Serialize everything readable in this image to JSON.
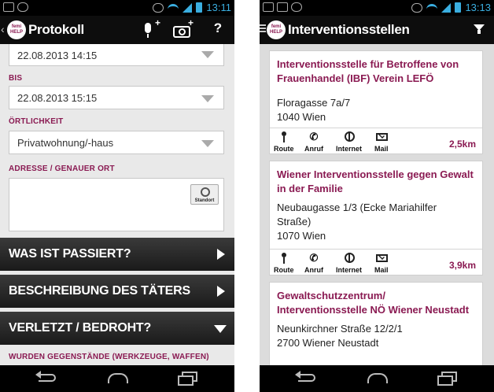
{
  "left": {
    "status_time": "13:11",
    "title": "Protokoll",
    "logo_text_1": "femi",
    "logo_text_2": "HELP",
    "help_label": "?",
    "start_value": "22.08.2013 14:15",
    "bis_label": "BIS",
    "bis_value": "22.08.2013 15:15",
    "oertlichkeit_label": "ÖRTLICHKEIT",
    "oertlichkeit_value": "Privatwohnung/-haus",
    "adresse_label": "ADRESSE / GENAUER ORT",
    "standort_label": "Standort",
    "sections": [
      "WAS IST PASSIERT?",
      "BESCHREIBUNG DES TÄTERS",
      "VERLETZT / BEDROHT?"
    ],
    "gegenstaende_label": "WURDEN GEGENSTÄNDE (WERKZEUGE, WAFFEN)"
  },
  "right": {
    "status_time": "13:13",
    "title": "Interventionsstellen",
    "logo_text_1": "femi",
    "logo_text_2": "HELP",
    "actions": [
      "Route",
      "Anruf",
      "Internet",
      "Mail"
    ],
    "cards": [
      {
        "title_1": "Interventionsstelle für Betroffene von",
        "title_2": "Frauenhandel (IBF) Verein LEFÖ",
        "addr_1": "Floragasse  7a/7",
        "addr_2": "1040 Wien",
        "addr_3": "",
        "distance": "2,5km"
      },
      {
        "title_1": "Wiener Interventionsstelle gegen Gewalt",
        "title_2": "in der Familie",
        "addr_1": "Neubaugasse 1/3 (Ecke Mariahilfer",
        "addr_2": "Straße)",
        "addr_3": "1070 Wien",
        "distance": "3,9km"
      },
      {
        "title_1": "Gewaltschutzzentrum/",
        "title_2": "Interventionsstelle NÖ Wiener Neustadt",
        "addr_1": "Neunkirchner Straße 12/2/1",
        "addr_2": "2700 Wiener Neustadt",
        "addr_3": "",
        "distance": ""
      }
    ]
  },
  "colors": {
    "accent": "#8a1a52",
    "statusbar_accent": "#3aaee0"
  }
}
